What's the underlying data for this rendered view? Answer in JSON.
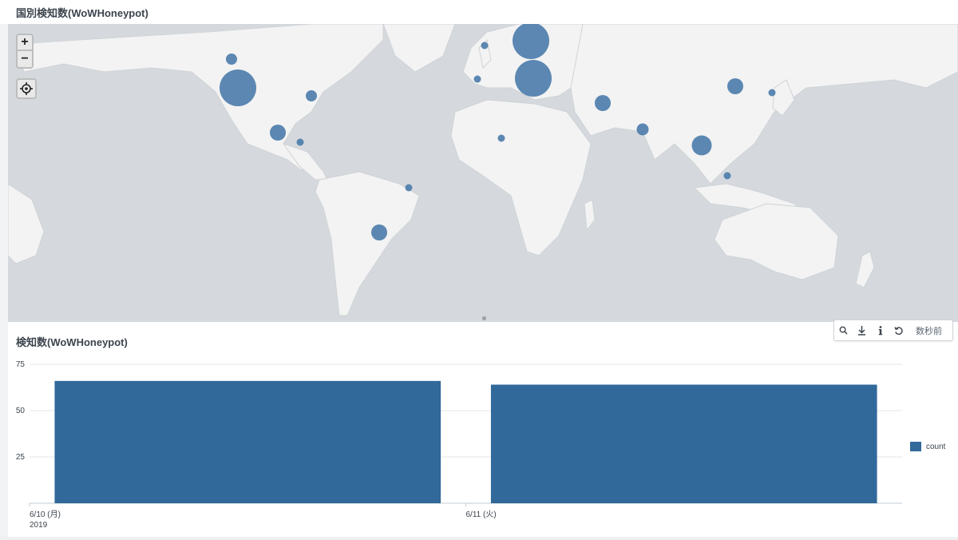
{
  "map_panel": {
    "title": "国別検知数(WoWHoneypot)",
    "controls": {
      "zoom_in": "+",
      "zoom_out": "−"
    }
  },
  "toolbar": {
    "search_icon": "search-icon",
    "download_icon": "download-icon",
    "info_icon": "info-icon",
    "refresh_icon": "refresh-icon",
    "updated_text": "数秒前"
  },
  "chart_panel": {
    "title": "検知数(WoWHoneypot)"
  },
  "chart_data": {
    "type": "bar",
    "title": "検知数(WoWHoneypot)",
    "categories": [
      "6/10 (月)",
      "6/11 (火)"
    ],
    "category_year": "2019",
    "series": [
      {
        "name": "count",
        "values": [
          66,
          64
        ]
      }
    ],
    "ylim": [
      0,
      75
    ],
    "yticks": [
      25,
      50,
      75
    ],
    "grid": true,
    "legend": "right",
    "colors": {
      "bar": "#31699a"
    }
  },
  "colors": {
    "marker": "#4a7bab",
    "ocean": "#d5d9dd",
    "land": "#f3f3f3"
  }
}
